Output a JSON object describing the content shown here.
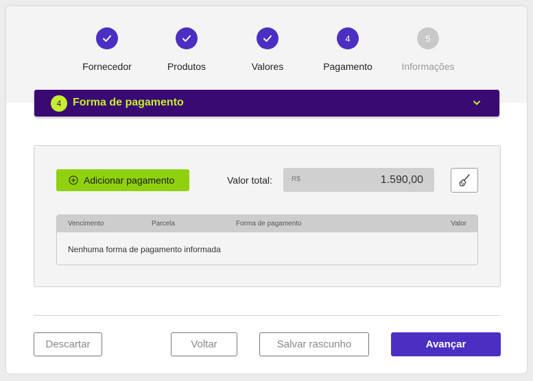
{
  "stepper": {
    "steps": [
      {
        "label": "Fornecedor",
        "state": "done"
      },
      {
        "label": "Produtos",
        "state": "done"
      },
      {
        "label": "Valores",
        "state": "done"
      },
      {
        "label": "Pagamento",
        "state": "current",
        "number": "4"
      },
      {
        "label": "Informações",
        "state": "future",
        "number": "5"
      }
    ]
  },
  "section": {
    "number": "4",
    "title": "Forma de pagamento"
  },
  "payment": {
    "add_button": "Adicionar pagamento",
    "total_label": "Valor total:",
    "currency": "R$",
    "total_value": "1.590,00"
  },
  "table": {
    "columns": [
      "Vencimento",
      "Parcela",
      "Forma de pagamento",
      "Valor"
    ],
    "empty_message": "Nenhuma forma de pagamento informada"
  },
  "footer": {
    "discard": "Descartar",
    "back": "Voltar",
    "save_draft": "Salvar rascunho",
    "next": "Avançar"
  },
  "colors": {
    "primary": "#4b2fc2",
    "header_bg": "#3a0a73",
    "accent_lime": "#c5ee2e",
    "add_button": "#8fd10e"
  }
}
